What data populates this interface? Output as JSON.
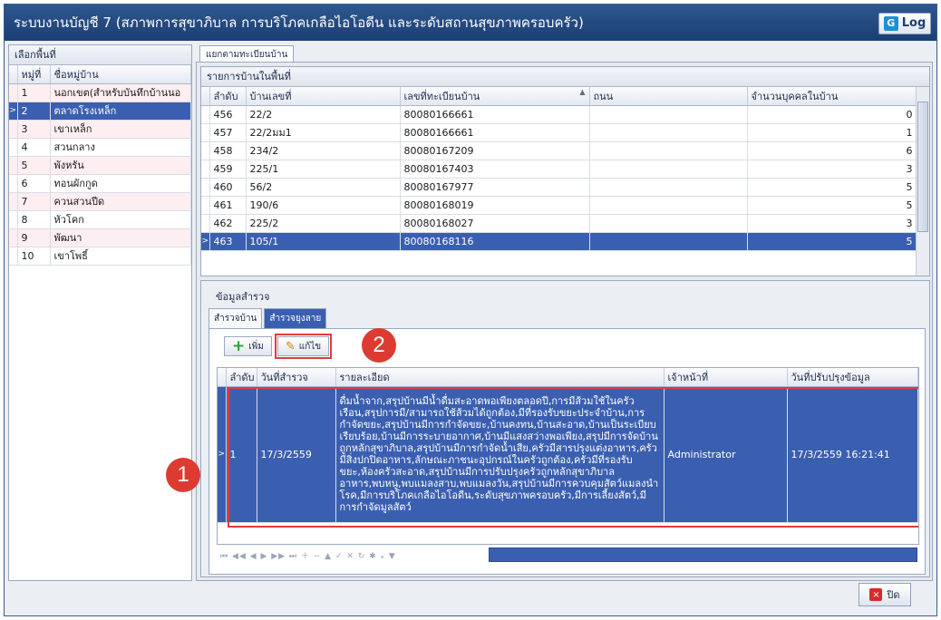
{
  "window": {
    "title": "ระบบงานบัญชี 7 (สภาพการสุขาภิบาล การบริโภคเกลือไอโอดีน และระดับสถานสุขภาพครอบครัว)",
    "log_label": "Log",
    "log_icon": "G",
    "close_label": "ปิด",
    "close_icon": "×"
  },
  "area_panel": {
    "title": "เลือกพื้นที่",
    "columns": [
      "หมู่ที่",
      "ชื่อหมู่บ้าน"
    ],
    "rows": [
      {
        "no": "1",
        "name": "นอกเขต(สำหรับบันทึกบ้านนอ"
      },
      {
        "no": "2",
        "name": "ตลาดโรงเหล็ก"
      },
      {
        "no": "3",
        "name": "เขาเหล็ก"
      },
      {
        "no": "4",
        "name": "สวนกลาง"
      },
      {
        "no": "5",
        "name": "พังหรัน"
      },
      {
        "no": "6",
        "name": "ทอนผักกูด"
      },
      {
        "no": "7",
        "name": "ควนสวนปีด"
      },
      {
        "no": "8",
        "name": "หัวโคก"
      },
      {
        "no": "9",
        "name": "พัฒนา"
      },
      {
        "no": "10",
        "name": "เขาโพธิ์"
      }
    ],
    "selected_marker": ">"
  },
  "house_tab": "แยกตามทะเบียนบ้าน",
  "houses": {
    "title": "รายการบ้านในพื้นที่",
    "columns": [
      "ลำดับ",
      "บ้านเลขที่",
      "เลขที่ทะเบียนบ้าน",
      "ถนน",
      "จำนวนบุคคลในบ้าน"
    ],
    "sort_icon": "▲",
    "rows": [
      {
        "seq": "456",
        "house_no": "22/2",
        "reg_no": "80080166661",
        "road": "",
        "count": "0"
      },
      {
        "seq": "457",
        "house_no": "22/2มม1",
        "reg_no": "80080166661",
        "road": "",
        "count": "1"
      },
      {
        "seq": "458",
        "house_no": "234/2",
        "reg_no": "80080167209",
        "road": "",
        "count": "6"
      },
      {
        "seq": "459",
        "house_no": "225/1",
        "reg_no": "80080167403",
        "road": "",
        "count": "3"
      },
      {
        "seq": "460",
        "house_no": "56/2",
        "reg_no": "80080167977",
        "road": "",
        "count": "5"
      },
      {
        "seq": "461",
        "house_no": "190/6",
        "reg_no": "80080168019",
        "road": "",
        "count": "5"
      },
      {
        "seq": "462",
        "house_no": "225/2",
        "reg_no": "80080168027",
        "road": "",
        "count": "3"
      },
      {
        "seq": "463",
        "house_no": "105/1",
        "reg_no": "80080168116",
        "road": "",
        "count": "5"
      }
    ]
  },
  "survey": {
    "title": "ข้อมูลสำรวจ",
    "tabs": [
      "สำรวจบ้าน",
      "สำรวจยุงลาย"
    ],
    "add_label": "เพิ่ม",
    "edit_label": "แก้ไข",
    "columns": [
      "ลำดับ",
      "วันที่สำรวจ",
      "รายละเอียด",
      "เจ้าหน้าที่",
      "วันที่ปรับปรุงข้อมูล"
    ],
    "row": {
      "seq": "1",
      "date": "17/3/2559",
      "detail": "ดื่มน้ำจาก,สรุปบ้านมีน้ำดื่มสะอาดพอเพียงตลอดปี,การมีส้วมใช้ในครัวเรือน,สรุปการมี/สามารถใช้ส้วมได้ถูกต้อง,มีที่รองรับขยะประจำบ้าน,การกำจัดขยะ,สรุปบ้านมีการกำจัดขยะ,บ้านคงทน,บ้านสะอาด,บ้านเป็นระเบียบเรียบร้อย,บ้านมีการระบายอากาศ,บ้านมีแสงสว่างพอเพียง,สรุปมีการจัดบ้านถูกหลักสุขาภิบาล,สรุปบ้านมีการกำจัดน้ำเสีย,ครัวมีสารปรุงแต่งอาหาร,ครัวมีสิ่งปกปิดอาหาร,ลักษณะภาชนะอุปกรณ์ในครัวถูกต้อง,ครัวมีที่รองรับขยะ,ห้องครัวสะอาด,สรุปบ้านมีการปรับปรุงครัวถูกหลักสุขาภิบาลอาหาร,พบหนู,พบแมลงสาบ,พบแมลงวัน,สรุปบ้านมีการควบคุมสัตว์แมลงนำโรค,มีการบริโภคเกลือไอโอดีน,ระดับสุขภาพครอบครัว,มีการเลี้ยงสัตว์,มีการกำจัดมูลสัตว์",
      "officer": "Administrator",
      "updated": "17/3/2559 16:21:41"
    },
    "nav_icons": "⏮ ◀◀ ◀ ▶ ▶▶ ⏭ ＋ − ▲ ✓ ✕ ↻ ✱ ⁎ ▼"
  },
  "callouts": {
    "one": "1",
    "two": "2"
  }
}
